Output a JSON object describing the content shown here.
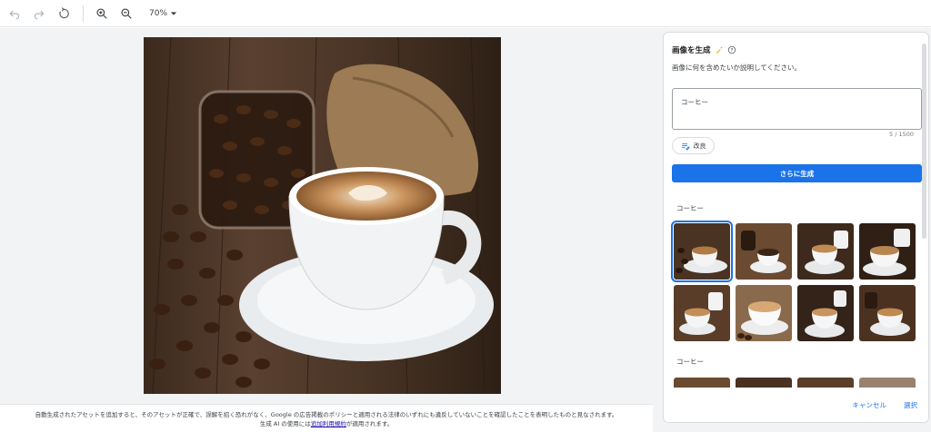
{
  "toolbar": {
    "undo_icon": "undo-icon",
    "redo_icon": "redo-icon",
    "reset_icon": "reset-icon",
    "zoom_in_icon": "zoom-in-icon",
    "zoom_out_icon": "zoom-out-icon",
    "zoom_level": "70%"
  },
  "footer": {
    "line1": "自動生成されたアセットを追加すると、そのアセットが正確で、誤解を招く恐れがなく、Google の広告掲載のポリシーと適用される法律のいずれにも違反していないことを確認したことを表明したものと見なされます。",
    "line2_prefix": "生成 AI の使用には",
    "line2_link": "追加利用規約",
    "line2_suffix": "が適用されます。"
  },
  "panel": {
    "title": "画像を生成",
    "subtitle": "画像に何を含めたいか説明してください。",
    "prompt_value": "コーヒー",
    "char_count": "5 / 1500",
    "refine_label": "改良",
    "generate_label": "さらに生成",
    "section1_label": "コーヒー",
    "section2_label": "コーヒー",
    "cancel_label": "キャンセル",
    "select_label": "選択"
  },
  "colors": {
    "accent": "#1a73e8",
    "canvas_bg": "#f1f3f4"
  }
}
